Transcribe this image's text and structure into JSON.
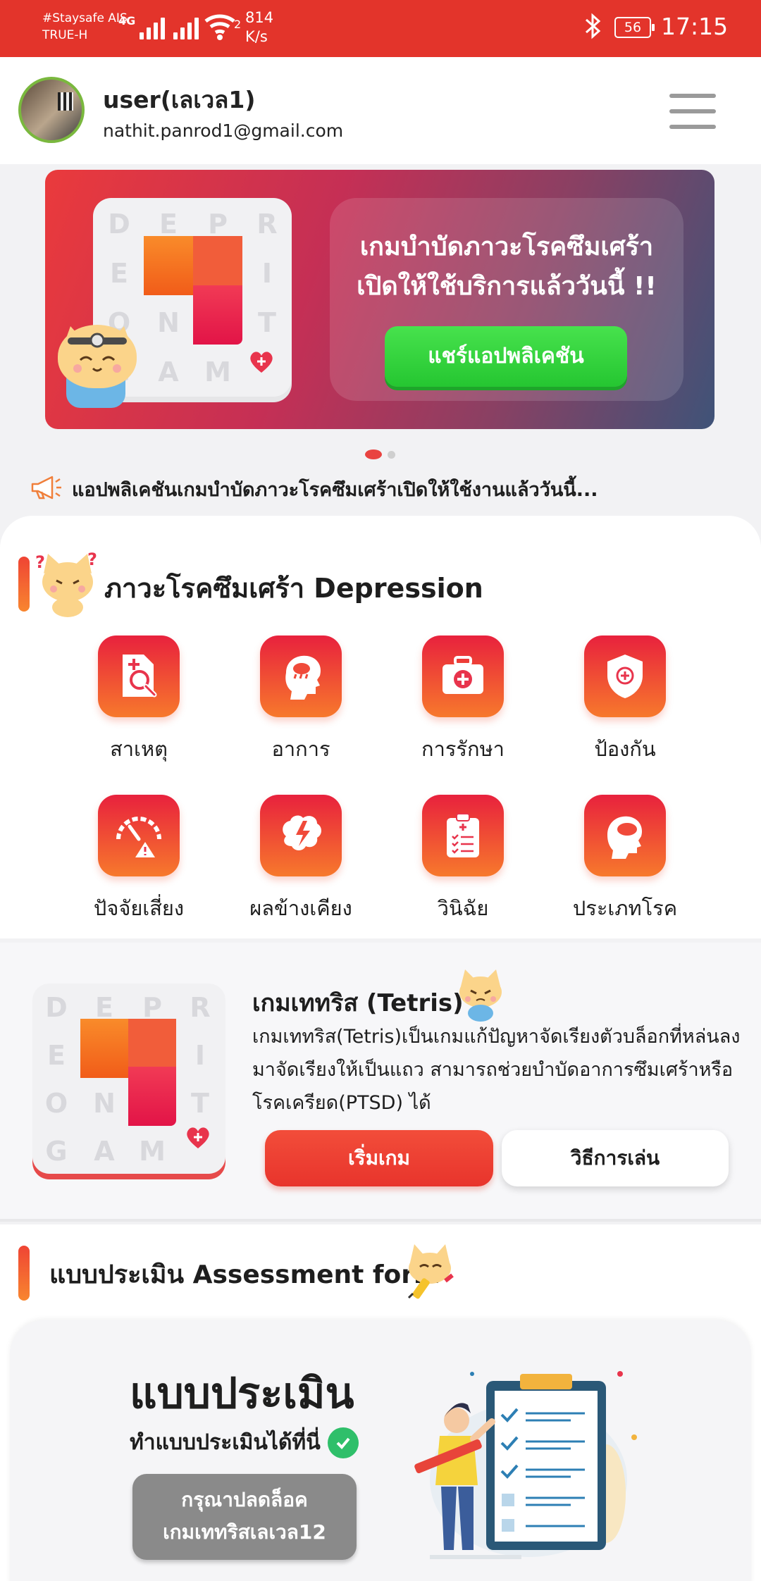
{
  "status_bar": {
    "carrier_line1": "#Staysafe AIS",
    "carrier_line2": "TRUE-H",
    "network_type": "4G",
    "wifi_badge": "2",
    "speed_value": "814",
    "speed_unit": "K/s",
    "battery": "56",
    "time": "17:15",
    "icons": [
      "signal-icon",
      "wifi-icon",
      "bluetooth-icon",
      "battery-icon"
    ]
  },
  "header": {
    "user_name": "user(เลเวล1)",
    "email": "nathit.panrod1@gmail.com",
    "menu_icon": "hamburger-menu-icon"
  },
  "banner": {
    "title_line1": "เกมบำบัดภาวะโรคซึมเศร้า",
    "title_line2": "เปิดให้ใช้บริการแล้ววันนี้ !!",
    "share_button": "แชร์แอปพลิเคชัน",
    "board_letters": [
      "D",
      "E",
      "P",
      "R",
      "E",
      "",
      "",
      "I",
      "O",
      "N",
      "",
      "T",
      "G",
      "A",
      "M",
      ""
    ],
    "slide_count": 2,
    "active_slide": 1
  },
  "announcement": {
    "icon": "megaphone-icon",
    "text": "แอปพลิเคชันเกมบำบัดภาวะโรคซึมเศร้าเปิดให้ใช้งานแล้ววันนี้..."
  },
  "depression_section": {
    "title": "ภาวะโรคซึมเศร้า Depression",
    "items": [
      {
        "label": "สาเหตุ",
        "icon": "document-search-icon"
      },
      {
        "label": "อาการ",
        "icon": "head-storm-icon"
      },
      {
        "label": "การรักษา",
        "icon": "first-aid-kit-icon"
      },
      {
        "label": "ป้องกัน",
        "icon": "shield-icon"
      },
      {
        "label": "ปัจจัยเสี่ยง",
        "icon": "gauge-warning-icon"
      },
      {
        "label": "ผลข้างเคียง",
        "icon": "brain-lightning-icon"
      },
      {
        "label": "วินิฉัย",
        "icon": "clipboard-checklist-icon"
      },
      {
        "label": "ประเภทโรค",
        "icon": "head-cloud-icon"
      }
    ]
  },
  "game_card": {
    "title": "เกมเททริส (Tetris)",
    "description": "เกมเททริส(Tetris)เป็นเกมแก้ปัญหาจัดเรียงตัวบล็อกที่หล่นลงมาจัดเรียงให้เป็นแถว สามารถช่วยบำบัดอาการซึมเศร้าหรือโรคเครียด(PTSD) ได้",
    "start_button": "เริ่มเกม",
    "howto_button": "วิธีการเล่น",
    "board_letters": [
      "D",
      "E",
      "P",
      "R",
      "E",
      "",
      "",
      "I",
      "O",
      "N",
      "",
      "T",
      "G",
      "A",
      "M",
      ""
    ]
  },
  "assessment": {
    "section_title": "แบบประเมิน Assessment form",
    "card_title": "แบบประเมิน",
    "card_subtitle": "ทำแบบประเมินได้ที่นี่",
    "unlock_line1": "กรุณาปลดล็อค",
    "unlock_line2": "เกมเททริสเลเวล12"
  },
  "colors": {
    "status_bar": "#e3342b",
    "accent_red": "#e8342c",
    "accent_orange": "#f7792c",
    "share_green": "#2fcf3a",
    "disabled_gray": "#8a8a8a"
  }
}
